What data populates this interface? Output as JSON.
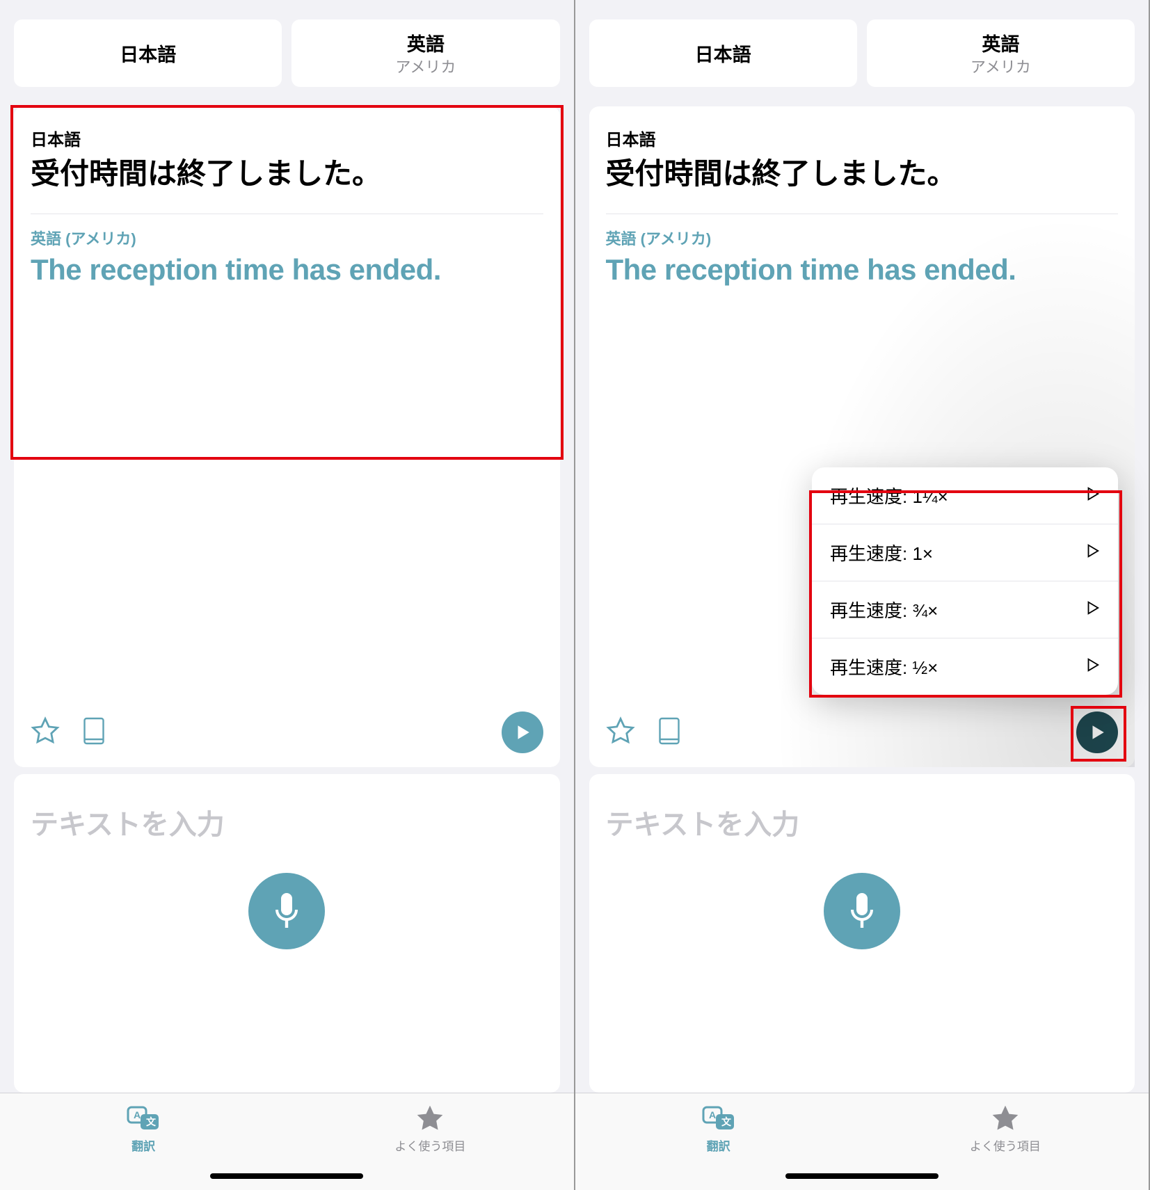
{
  "left": {
    "lang": {
      "src": {
        "primary": "日本語",
        "secondary": ""
      },
      "tgt": {
        "primary": "英語",
        "secondary": "アメリカ"
      }
    },
    "card": {
      "src_label": "日本語",
      "src_text": "受付時間は終了しました。",
      "tgt_label": "英語 (アメリカ)",
      "tgt_text": "The reception time has ended."
    },
    "input_placeholder": "テキストを入力",
    "tabs": {
      "translate": "翻訳",
      "favorites": "よく使う項目"
    }
  },
  "right": {
    "lang": {
      "src": {
        "primary": "日本語",
        "secondary": ""
      },
      "tgt": {
        "primary": "英語",
        "secondary": "アメリカ"
      }
    },
    "card": {
      "src_label": "日本語",
      "src_text": "受付時間は終了しました。",
      "tgt_label": "英語 (アメリカ)",
      "tgt_text": "The reception time has ended."
    },
    "speed_menu": {
      "items": [
        "再生速度: 1¼×",
        "再生速度: 1×",
        "再生速度: ¾×",
        "再生速度: ½×"
      ]
    },
    "input_placeholder": "テキストを入力",
    "tabs": {
      "translate": "翻訳",
      "favorites": "よく使う項目"
    }
  }
}
